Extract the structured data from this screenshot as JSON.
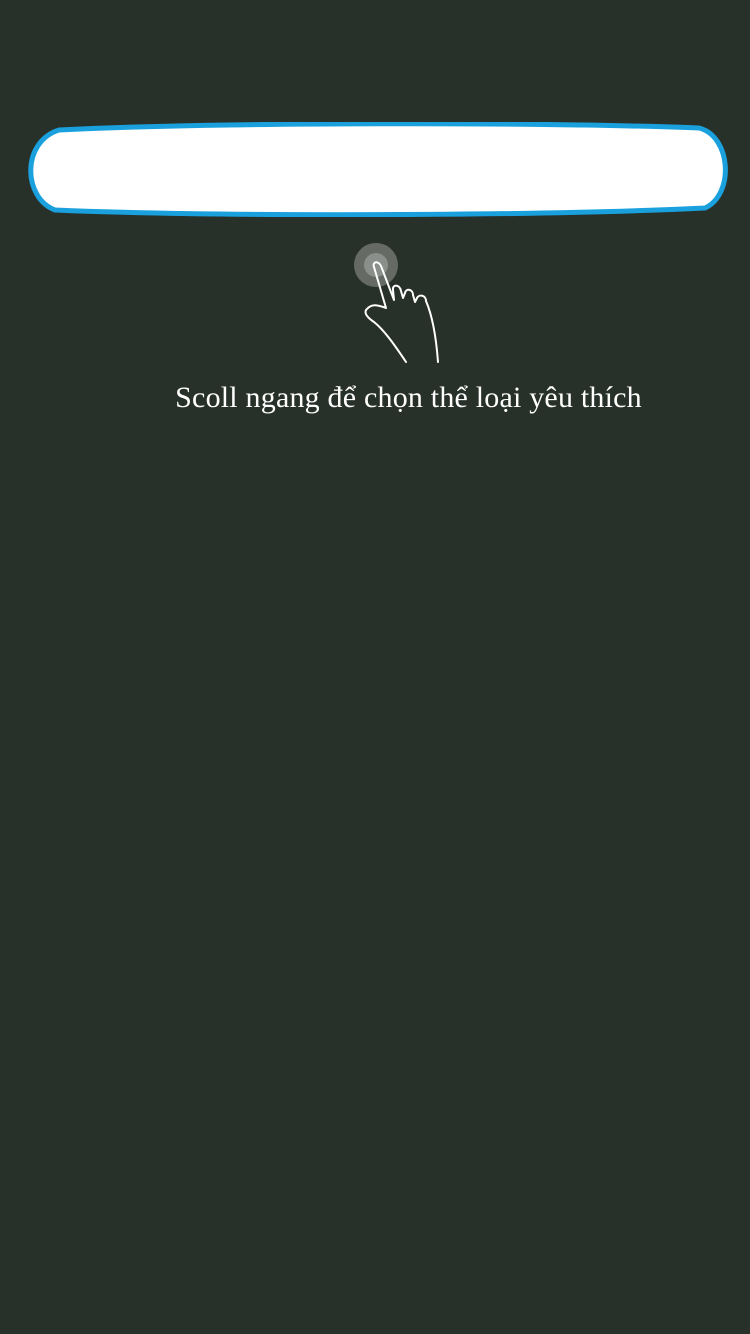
{
  "onboarding": {
    "hint_text": "Scoll ngang để chọn thể loại yêu thích",
    "gesture_icon": "swipe-hand-icon",
    "colors": {
      "background": "#283129",
      "highlight_fill": "#ffffff",
      "highlight_border": "#1aa0dc",
      "text": "#ffffff"
    }
  }
}
